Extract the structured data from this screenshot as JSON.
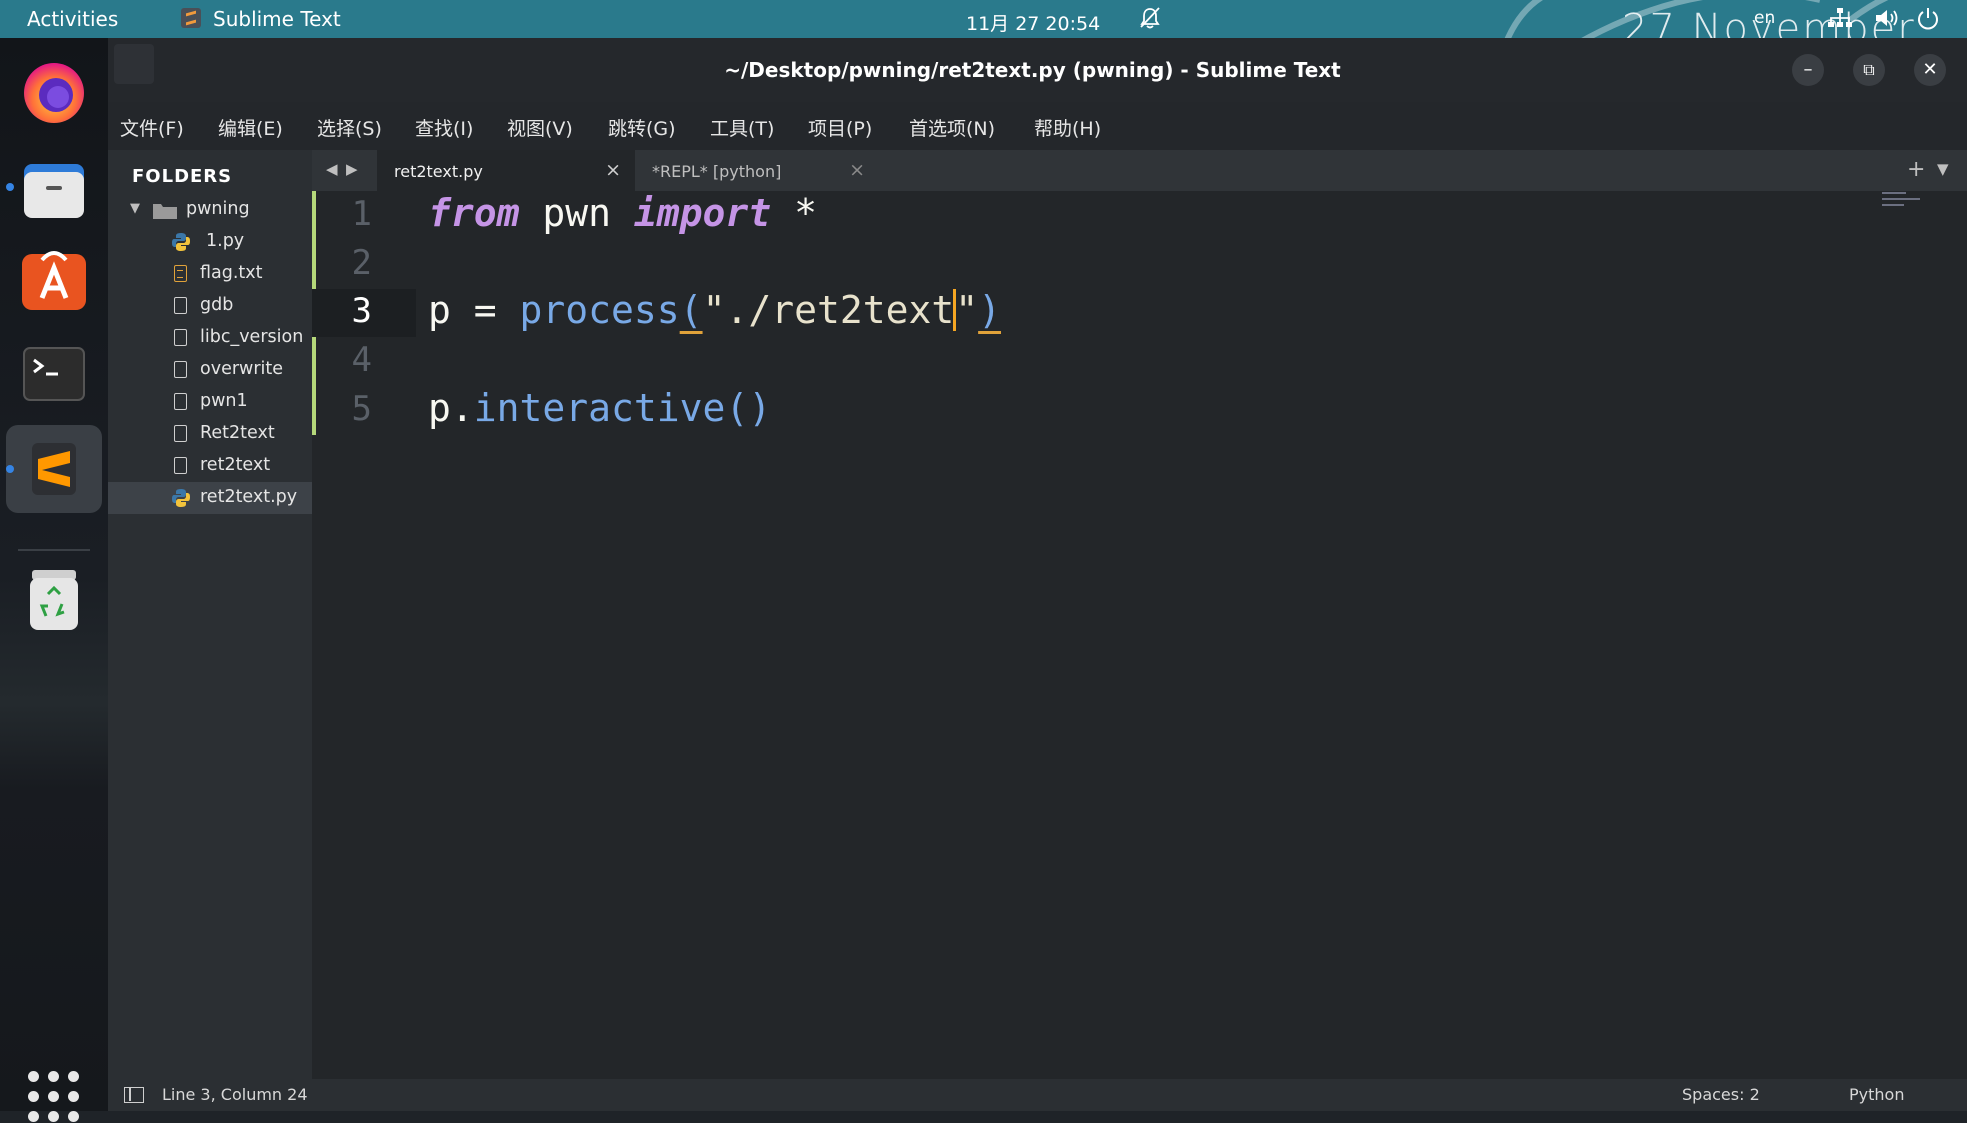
{
  "topbar": {
    "activities": "Activities",
    "app_name": "Sublime Text",
    "clock": "11月 27  20:54",
    "lang": "en",
    "wallpaper_date": "27 November",
    "icons": [
      "bell-muted-icon",
      "network-icon",
      "volume-icon",
      "power-icon"
    ]
  },
  "dock": {
    "apps": [
      "firefox",
      "files",
      "app-center",
      "terminal",
      "sublime-text",
      "trash"
    ],
    "active": "sublime-text"
  },
  "window": {
    "title": "~/Desktop/pwning/ret2text.py (pwning) - Sublime Text",
    "minimize": "–",
    "restore": "⧉",
    "close": "✕"
  },
  "menu": [
    "文件(F)",
    "编辑(E)",
    "选择(S)",
    "查找(I)",
    "视图(V)",
    "跳转(G)",
    "工具(T)",
    "项目(P)",
    "首选项(N)",
    "帮助(H)"
  ],
  "sidebar": {
    "header": "FOLDERS",
    "root": "pwning",
    "files": [
      {
        "name": "1.py",
        "type": "python"
      },
      {
        "name": "flag.txt",
        "type": "text"
      },
      {
        "name": "gdb",
        "type": "file"
      },
      {
        "name": "libc_version",
        "type": "file"
      },
      {
        "name": "overwrite",
        "type": "file"
      },
      {
        "name": "pwn1",
        "type": "file"
      },
      {
        "name": "Ret2text",
        "type": "file"
      },
      {
        "name": "ret2text",
        "type": "file"
      },
      {
        "name": "ret2text.py",
        "type": "python",
        "selected": true
      }
    ]
  },
  "tabs": [
    {
      "label": "ret2text.py",
      "active": true,
      "close": "×"
    },
    {
      "label": "*REPL* [python]",
      "active": false,
      "close": "×"
    }
  ],
  "editor": {
    "line_numbers": [
      "1",
      "2",
      "3",
      "4",
      "5"
    ],
    "current_line": 3,
    "code": {
      "l1_from": "from",
      "l1_mod": " pwn ",
      "l1_import": "import",
      "l1_star": " *",
      "l3_var": "p = ",
      "l3_fn": "process",
      "l3_open": "(",
      "l3_str_a": "\"./ret2text",
      "l3_str_b": "\"",
      "l3_close": ")",
      "l5_obj": "p.",
      "l5_fn": "interactive",
      "l5_paren": "()"
    }
  },
  "statusbar": {
    "position": "Line 3, Column 24",
    "spaces": "Spaces: 2",
    "syntax": "Python"
  },
  "colors": {
    "topbar": "#2a7a8c",
    "keyword": "#c594e6",
    "function": "#79a9e6",
    "caret": "#f5a623",
    "modified_bar": "#b5d87a"
  }
}
